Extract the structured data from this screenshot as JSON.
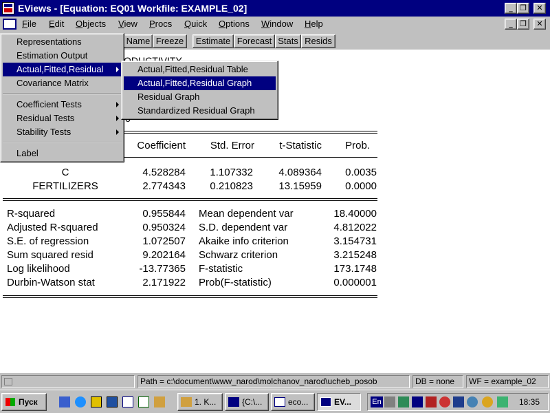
{
  "window": {
    "title": "EViews - [Equation: EQ01   Workfile: EXAMPLE_02]",
    "minimize_glyph": "_",
    "restore_glyph": "❐",
    "close_glyph": "✕"
  },
  "menubar": {
    "items": [
      "File",
      "Edit",
      "Objects",
      "View",
      "Procs",
      "Quick",
      "Options",
      "Window",
      "Help"
    ],
    "underline": [
      "F",
      "E",
      "O",
      "V",
      "P",
      "Q",
      "O",
      "W",
      "H"
    ]
  },
  "toolbar": {
    "buttons": [
      "Name",
      "Freeze",
      "Estimate",
      "Forecast",
      "Stats",
      "Resids"
    ]
  },
  "view_menu": {
    "items": [
      "Representations",
      "Estimation Output",
      "Actual,Fitted,Residual",
      "Covariance Matrix",
      "Coefficient Tests",
      "Residual Tests",
      "Stability Tests",
      "Label"
    ],
    "selected": "Actual,Fitted,Residual"
  },
  "submenu": {
    "items": [
      "Actual,Fitted,Residual Table",
      "Actual,Fitted,Residual Graph",
      "Residual Graph",
      "Standardized Residual Graph"
    ],
    "selected": "Actual,Fitted,Residual Graph"
  },
  "equation": {
    "partial_dependent": "ODUCTIVITY",
    "partial_line": "o",
    "headers": [
      "Coefficient",
      "Std. Error",
      "t-Statistic",
      "Prob."
    ],
    "rows": [
      {
        "var": "C",
        "coef": "4.528284",
        "se": "1.107332",
        "t": "4.089364",
        "p": "0.0035"
      },
      {
        "var": "FERTILIZERS",
        "coef": "2.774343",
        "se": "0.210823",
        "t": "13.15959",
        "p": "0.0000"
      }
    ],
    "stats": [
      {
        "l": "R-squared",
        "lv": "0.955844",
        "r": "Mean dependent var",
        "rv": "18.40000"
      },
      {
        "l": "Adjusted R-squared",
        "lv": "0.950324",
        "r": "S.D. dependent var",
        "rv": "4.812022"
      },
      {
        "l": "S.E. of regression",
        "lv": "1.072507",
        "r": "Akaike info criterion",
        "rv": "3.154731"
      },
      {
        "l": "Sum squared resid",
        "lv": "9.202164",
        "r": "Schwarz criterion",
        "rv": "3.215248"
      },
      {
        "l": "Log likelihood",
        "lv": "-13.77365",
        "r": "F-statistic",
        "rv": "173.1748"
      },
      {
        "l": "Durbin-Watson stat",
        "lv": "2.171922",
        "r": "Prob(F-statistic)",
        "rv": "0.000001"
      }
    ]
  },
  "statusbar": {
    "path": "Path = c:\\document\\www_narod\\molchanov_narod\\ucheb_posob",
    "db": "DB = none",
    "wf": "WF = example_02"
  },
  "taskbar": {
    "start": "Пуск",
    "tasks": [
      "1. K...",
      "{C:\\...",
      "eco...",
      "EV..."
    ],
    "lang": "En",
    "clock": "18:35"
  }
}
